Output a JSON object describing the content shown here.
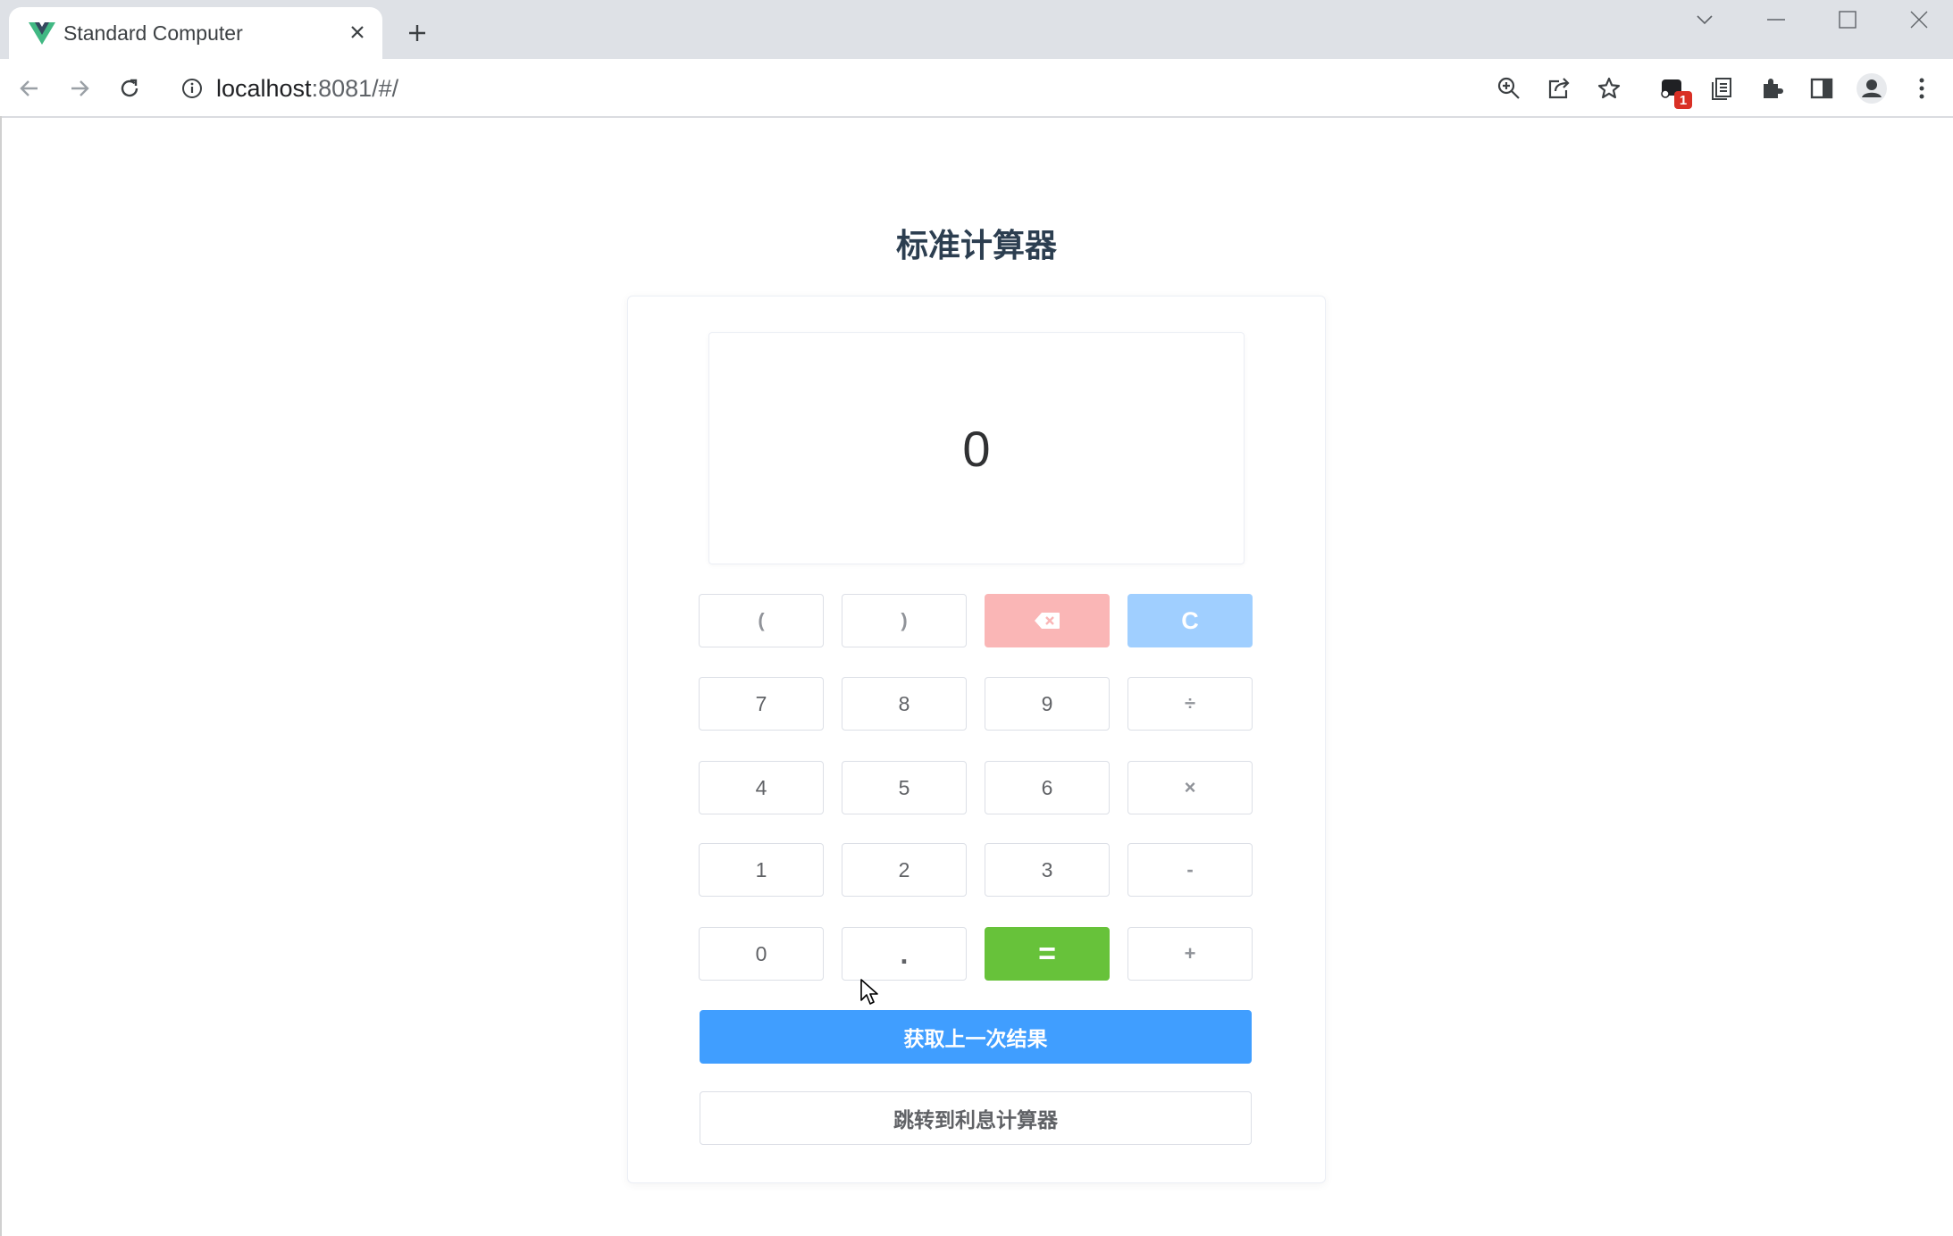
{
  "browser": {
    "tab_title": "Standard Computer",
    "url_host": "localhost",
    "url_rest": ":8081/#/",
    "extension_badge": "1",
    "icons": [
      "vue-logo-icon",
      "close-icon",
      "plus-icon",
      "back-icon",
      "forward-icon",
      "reload-icon",
      "info-icon",
      "zoom-icon",
      "share-icon",
      "star-icon",
      "extension-icon",
      "reading-list-icon",
      "puzzle-icon",
      "side-panel-icon",
      "profile-icon",
      "menu-icon"
    ]
  },
  "page": {
    "title": "标准计算器",
    "display_value": "0"
  },
  "keys": {
    "row1": [
      "(",
      ")",
      "",
      "C"
    ],
    "row2": [
      "7",
      "8",
      "9",
      "÷"
    ],
    "row3": [
      "4",
      "5",
      "6",
      "×"
    ],
    "row4": [
      "1",
      "2",
      "3",
      "-"
    ],
    "row5": [
      "0",
      ".",
      "=",
      "+"
    ]
  },
  "buttons": {
    "last_result": "获取上一次结果",
    "goto_interest": "跳转到利息计算器"
  },
  "colors": {
    "primary": "#409eff",
    "success": "#67c23a",
    "danger_light": "#fab6b6",
    "primary_light": "#a0cfff",
    "title": "#2c3e50"
  }
}
